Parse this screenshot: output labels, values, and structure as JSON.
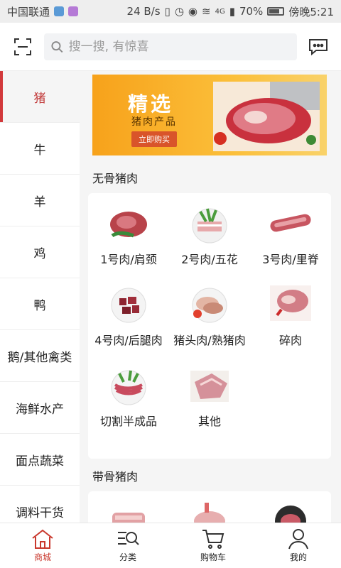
{
  "statusbar": {
    "carrier": "中国联通",
    "speed": "24 B/s",
    "network": "4G",
    "battery": "70%",
    "time": "傍晚5:21"
  },
  "header": {
    "search_placeholder": "搜一搜, 有惊喜"
  },
  "categories": [
    {
      "label": "猪",
      "active": true
    },
    {
      "label": "牛"
    },
    {
      "label": "羊"
    },
    {
      "label": "鸡"
    },
    {
      "label": "鸭"
    },
    {
      "label": "鹅/其他禽类"
    },
    {
      "label": "海鲜水产"
    },
    {
      "label": "面点蔬菜"
    },
    {
      "label": "调料干货"
    }
  ],
  "banner": {
    "title": "精选",
    "subtitle": "猪肉产品",
    "button": "立即购买"
  },
  "sections": [
    {
      "title": "无骨猪肉",
      "items": [
        "1号肉/肩颈",
        "2号肉/五花",
        "3号肉/里脊",
        "4号肉/后腿肉",
        "猪头肉/熟猪肉",
        "碎肉",
        "切割半成品",
        "其他"
      ]
    },
    {
      "title": "带骨猪肉",
      "items": [
        "",
        "",
        ""
      ]
    }
  ],
  "tabbar": [
    {
      "label": "商城",
      "icon": "home-icon",
      "active": true
    },
    {
      "label": "分类",
      "icon": "category-search-icon"
    },
    {
      "label": "购物车",
      "icon": "cart-icon"
    },
    {
      "label": "我的",
      "icon": "user-icon"
    }
  ],
  "colors": {
    "accent": "#d2393b",
    "banner": "#f7a21b"
  }
}
